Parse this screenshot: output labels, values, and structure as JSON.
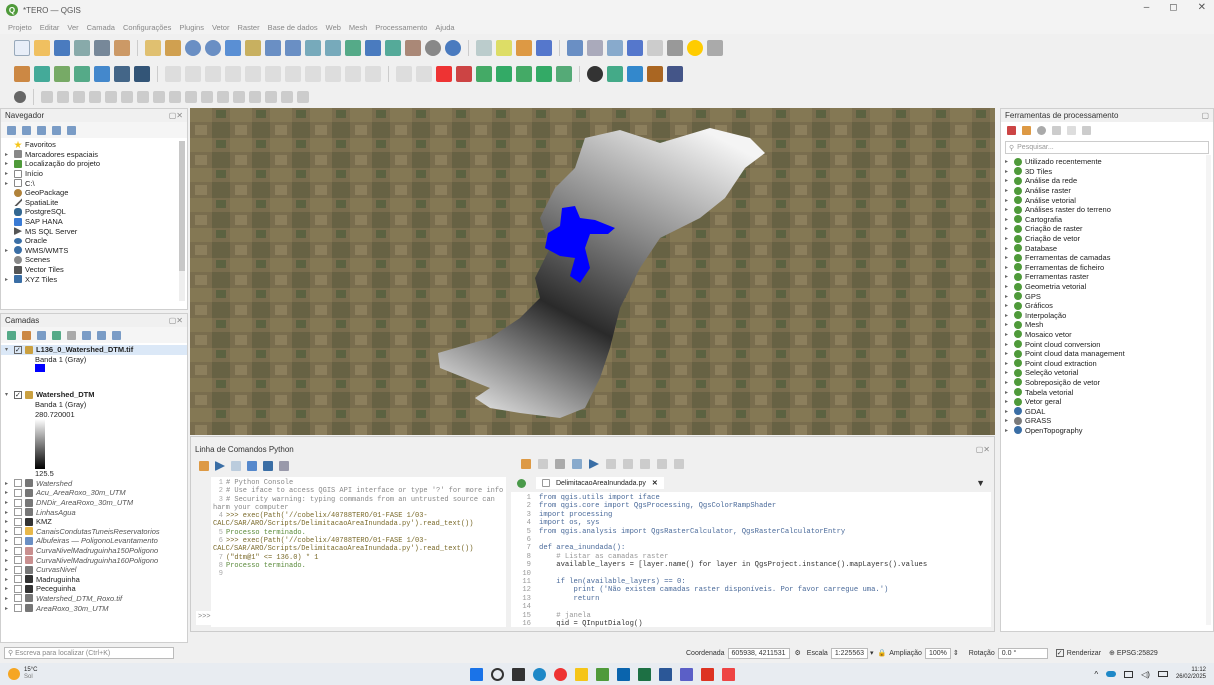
{
  "window": {
    "title": "*TERO — QGIS",
    "controls": [
      "–",
      "◻",
      "✕"
    ]
  },
  "menubar": [
    "Projeto",
    "Editar",
    "Ver",
    "Camada",
    "Configurações",
    "Plugins",
    "Vetor",
    "Raster",
    "Base de dados",
    "Web",
    "Mesh",
    "Processamento",
    "Ajuda"
  ],
  "navigator": {
    "title": "Navegador",
    "items": [
      {
        "label": "Favoritos",
        "icon": "star-icon",
        "color": "#f5c518"
      },
      {
        "label": "Marcadores espaciais",
        "icon": "bookmark-icon",
        "color": "#888"
      },
      {
        "label": "Localização do projeto",
        "icon": "project-home-icon",
        "color": "#4f9a3a"
      },
      {
        "label": "Início",
        "icon": "home-folder-icon",
        "color": "#888"
      },
      {
        "label": "C:\\",
        "icon": "drive-icon",
        "color": "#888"
      },
      {
        "label": "GeoPackage",
        "icon": "geopackage-icon",
        "color": "#b0823a"
      },
      {
        "label": "SpatiaLite",
        "icon": "spatialite-icon",
        "color": "#555"
      },
      {
        "label": "PostgreSQL",
        "icon": "postgresql-icon",
        "color": "#336791"
      },
      {
        "label": "SAP HANA",
        "icon": "sap-hana-icon",
        "color": "#3a7bd5"
      },
      {
        "label": "MS SQL Server",
        "icon": "mssql-icon",
        "color": "#555"
      },
      {
        "label": "Oracle",
        "icon": "oracle-icon",
        "color": "#3a6ea5"
      },
      {
        "label": "WMS/WMTS",
        "icon": "wms-icon",
        "color": "#3a6ea5"
      },
      {
        "label": "Scenes",
        "icon": "scenes-icon",
        "color": "#888"
      },
      {
        "label": "Vector Tiles",
        "icon": "vector-tiles-icon",
        "color": "#555"
      },
      {
        "label": "XYZ Tiles",
        "icon": "xyz-tiles-icon",
        "color": "#3a6ea5"
      }
    ]
  },
  "layers": {
    "title": "Camadas",
    "raster1": {
      "name": "L136_0_Watershed_DTM.tif",
      "band": "Banda 1 (Gray)",
      "swatch": "#0000ff"
    },
    "raster2": {
      "name": "Watershed_DTM",
      "band": "Banda 1 (Gray)",
      "max": "280.720001",
      "min": "125.5"
    },
    "items": [
      {
        "label": "Watershed",
        "italic": true,
        "color": "#777"
      },
      {
        "label": "Acu_AreaRoxo_30m_UTM",
        "italic": true,
        "color": "#777"
      },
      {
        "label": "DNDir_AreaRoxo_30m_UTM",
        "italic": true,
        "color": "#777"
      },
      {
        "label": "LinhasAgua",
        "italic": true,
        "color": "#777"
      },
      {
        "label": "KMZ",
        "italic": false,
        "color": "#333"
      },
      {
        "label": "CanaisCondutasTuneisReservatorios",
        "italic": true,
        "color": "#e8b84a"
      },
      {
        "label": "Albufeiras — PoligonoLevantamento",
        "italic": true,
        "color": "#6a8fc4"
      },
      {
        "label": "CurvaNivelMadruguinha150Poligono",
        "italic": true,
        "color": "#c98f8f"
      },
      {
        "label": "CurvaNivelMadruguinha160Poligono",
        "italic": true,
        "color": "#c98f8f"
      },
      {
        "label": "CurvasNivel",
        "italic": true,
        "color": "#777"
      },
      {
        "label": "Madruguinha",
        "italic": false,
        "color": "#333"
      },
      {
        "label": "Peceguinha",
        "italic": false,
        "color": "#333"
      },
      {
        "label": "Watershed_DTM_Roxo.tif",
        "italic": true,
        "color": "#777"
      },
      {
        "label": "AreaRoxo_30m_UTM",
        "italic": true,
        "color": "#777"
      }
    ]
  },
  "python_console": {
    "title": "Linha de Comandos Python",
    "output": [
      "# Python Console",
      "# Use iface to access QGIS API interface or type '?' for more info",
      "# Security warning: typing commands from an untrusted source can harm your computer",
      ">>> exec(Path('//cobelix/40788TERO/01-FASE 1/03-CALC/SAR/ARO/Scripts/DelimitacaoAreaInundada.py').read_text())",
      "Processo terminado.",
      ">>> exec(Path('//cobelix/40788TERO/01-FASE 1/03-CALC/SAR/ARO/Scripts/DelimitacaoAreaInundada.py').read_text())",
      "(\"dtm@1\" <= 136.0) * 1",
      "Processo terminado."
    ],
    "prompt": ">>>",
    "editor_tab": "DelimitacaoAreaInundada.py",
    "code": [
      "from qgis.utils import iface",
      "from qgis.core import QgsProcessing, QgsColorRampShader",
      "import processing",
      "import os, sys",
      "from qgis.analysis import QgsRasterCalculator, QgsRasterCalculatorEntry",
      "",
      "def area_inundada():",
      "    # Listar as camadas raster",
      "    available_layers = [layer.name() for layer in QgsProject.instance().mapLayers().values",
      "",
      "    if len(available_layers) == 0:",
      "        print ('Não existem camadas raster disponíveis. Por favor carregue uma.')",
      "        return",
      "",
      "    # janela",
      "    qid = QInputDialog()"
    ]
  },
  "toolbox": {
    "title": "Ferramentas de processamento",
    "search_placeholder": "Pesquisar...",
    "items": [
      "Utilizado recentemente",
      "3D Tiles",
      "Análise da rede",
      "Análise raster",
      "Análise vetorial",
      "Análises raster do terreno",
      "Cartografia",
      "Criação de raster",
      "Criação de vetor",
      "Database",
      "Ferramentas de camadas",
      "Ferramentas de ficheiro",
      "Ferramentas raster",
      "Geometria vetorial",
      "GPS",
      "Gráficos",
      "Interpolação",
      "Mesh",
      "Mosaico vetor",
      "Point cloud conversion",
      "Point cloud data management",
      "Point cloud extraction",
      "Seleção vetorial",
      "Sobreposição de vetor",
      "Tabela vetorial",
      "Vetor geral",
      "GDAL",
      "GRASS",
      "OpenTopography"
    ]
  },
  "statusbar": {
    "locator_placeholder": "Escreva para localizar (Ctrl+K)",
    "coord_label": "Coordenada",
    "coord_value": "605938, 4211531",
    "scale_label": "Escala",
    "scale_value": "1:225563",
    "zoom_label": "Ampliação",
    "zoom_value": "100%",
    "rotation_label": "Rotação",
    "rotation_value": "0.0 °",
    "render_label": "Renderizar",
    "crs": "EPSG:25829"
  },
  "taskbar": {
    "temp": "15°C",
    "weather": "Sol",
    "time": "11:12",
    "date": "26/02/2025"
  }
}
